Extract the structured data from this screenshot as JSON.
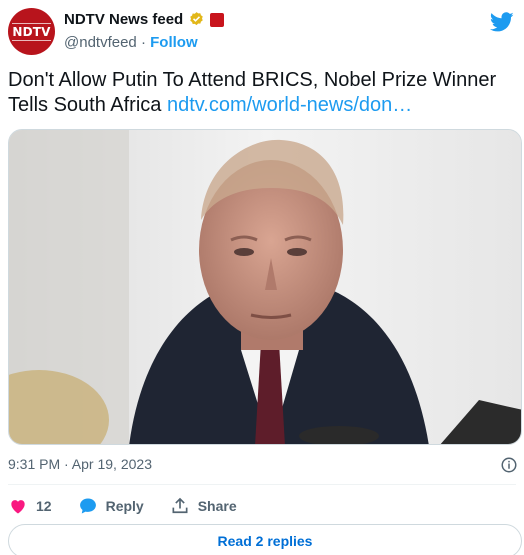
{
  "account": {
    "avatar_text": "NDTV",
    "display_name": "NDTV News feed",
    "handle": "@ndtvfeed",
    "separator": "·",
    "follow_label": "Follow",
    "brand_color": "#b8141c",
    "verified_color": "#e2b719"
  },
  "tweet": {
    "text": "Don't Allow Putin To Attend BRICS, Nobel Prize Winner Tells South Africa ",
    "link_text": "ndtv.com/world-news/don…",
    "timestamp": "9:31 PM · Apr 19, 2023"
  },
  "actions": {
    "like_count": "12",
    "reply_label": "Reply",
    "share_label": "Share"
  },
  "footer": {
    "read_replies_label": "Read 2 replies"
  },
  "icons": {
    "bird": "twitter-bird-icon",
    "verified": "verified-badge-icon",
    "info": "info-icon",
    "like": "heart-icon",
    "reply": "speech-bubble-icon",
    "share": "share-upload-icon"
  },
  "colors": {
    "accent": "#1d9bf0",
    "like": "#f91880",
    "muted": "#536471"
  }
}
